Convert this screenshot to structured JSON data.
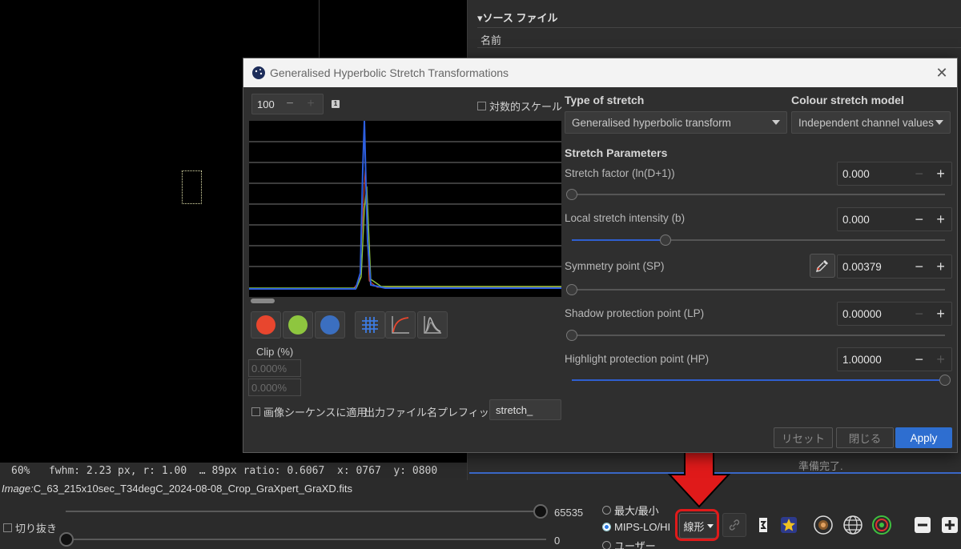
{
  "background": {
    "source_files_header": "▾ソース ファイル",
    "name_column": "名前",
    "status_ready": "準備完了.",
    "status_bar": "60%   fwhm: 2.23 px, r: 1.00  … 89px ratio: 0.6067  x: 0767  y: 0800",
    "image_label": "Image:",
    "image_file": "C_63_215x10sec_T34degC_2024-08-08_Crop_GraXpert_GraXD.fits"
  },
  "toolbar": {
    "crop_label": "切り抜き",
    "hi_value": "65535",
    "lo_value": "0",
    "radio_minmax": "最大/最小",
    "radio_mips": "MIPS-LO/HI",
    "radio_user": "ユーザー",
    "stretch_mode": "線形"
  },
  "dialog": {
    "title": "Generalised Hyperbolic Stretch Transformations",
    "zoom_value": "100",
    "one_badge": "1",
    "log_scale_label": "対数的スケール",
    "clip_label": "Clip (%)",
    "clip_lo": "0.000%",
    "clip_hi": "0.000%",
    "apply_sequence_label": "画像シーケンスに適用",
    "prefix_label": "出力ファイル名プレフィックス:",
    "prefix_value": "stretch_",
    "type_of_stretch_label": "Type of stretch",
    "type_of_stretch_value": "Generalised hyperbolic transform",
    "colour_model_label": "Colour stretch model",
    "colour_model_value": "Independent channel values",
    "stretch_params_label": "Stretch Parameters",
    "params": [
      {
        "label": "Stretch factor (ln(D+1))",
        "value": "0.000",
        "slider": 0.0
      },
      {
        "label": "Local stretch intensity (b)",
        "value": "0.000",
        "slider": 0.25
      },
      {
        "label": "Symmetry point (SP)",
        "value": "0.00379",
        "slider": 0.0
      },
      {
        "label": "Shadow protection point (LP)",
        "value": "0.00000",
        "slider": 0.0
      },
      {
        "label": "Highlight protection point (HP)",
        "value": "1.00000",
        "slider": 1.0
      }
    ],
    "reset_label": "リセット",
    "close_label": "閉じる",
    "apply_label": "Apply"
  },
  "colors": {
    "accent": "#2e6ed0",
    "highlight_red": "#e01a1a",
    "channel_red": "#e8462e",
    "channel_green": "#8ec63f",
    "channel_blue": "#3b6fc0"
  }
}
